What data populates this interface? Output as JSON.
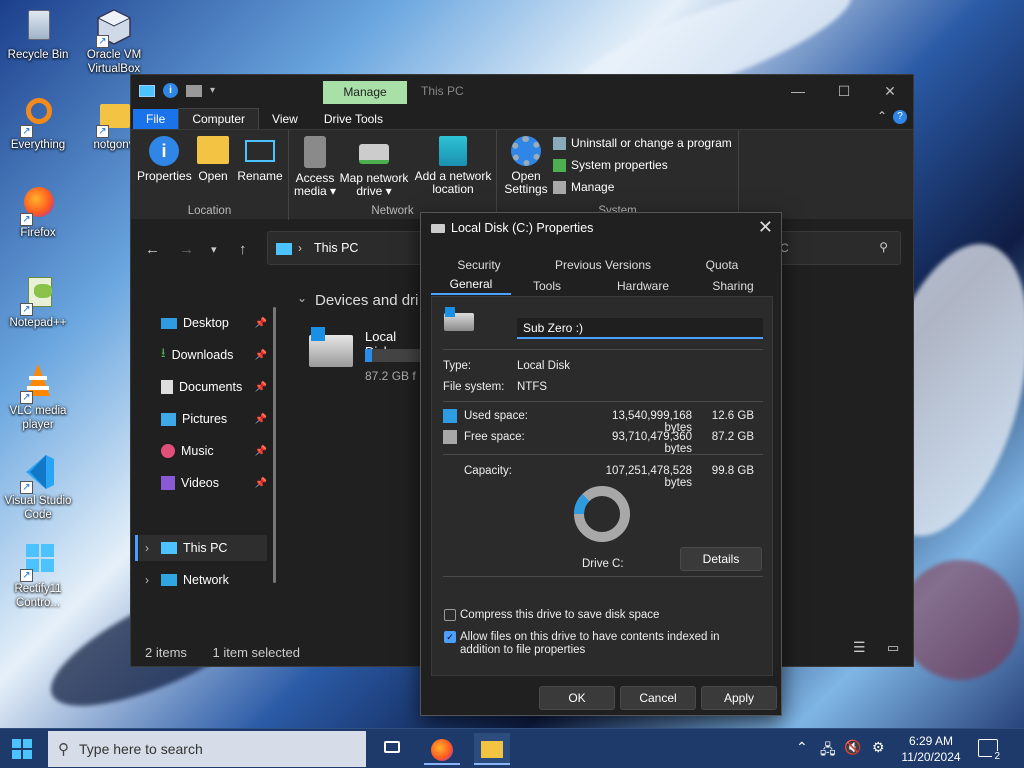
{
  "desktop": {
    "icons": [
      {
        "label": "Recycle Bin"
      },
      {
        "label": "Oracle VM VirtualBox"
      },
      {
        "label": "Everything"
      },
      {
        "label": "notgonv"
      },
      {
        "label": "Firefox"
      },
      {
        "label": "Notepad++"
      },
      {
        "label": "VLC media player"
      },
      {
        "label": "Visual Studio Code"
      },
      {
        "label": "Rectify11 Contro..."
      }
    ]
  },
  "explorer": {
    "manage_tab": "Manage",
    "title": "This PC",
    "tabs": [
      "File",
      "Computer",
      "View",
      "Drive Tools"
    ],
    "ribbon": {
      "location": {
        "name": "Location",
        "buttons": [
          "Properties",
          "Open",
          "Rename"
        ]
      },
      "network": {
        "name": "Network",
        "buttons": [
          "Access media ▾",
          "Map network drive ▾",
          "Add a network location"
        ]
      },
      "system": {
        "name": "System",
        "open_settings": "Open Settings",
        "items": [
          "Uninstall or change a program",
          "System properties",
          "Manage"
        ]
      }
    },
    "address": "This PC",
    "search_partial": "C",
    "section_header": "Devices and dri",
    "drive": {
      "name": "Local Disk",
      "free": "87.2 GB f",
      "used_fraction": 0.126
    },
    "nav": [
      {
        "label": "Desktop",
        "pinned": true
      },
      {
        "label": "Downloads",
        "pinned": true
      },
      {
        "label": "Documents",
        "pinned": true
      },
      {
        "label": "Pictures",
        "pinned": true
      },
      {
        "label": "Music",
        "pinned": true
      },
      {
        "label": "Videos",
        "pinned": true
      },
      {
        "label": "This PC",
        "pinned": false
      },
      {
        "label": "Network",
        "pinned": false
      }
    ],
    "status": {
      "items": "2 items",
      "selected": "1 item selected"
    }
  },
  "dialog": {
    "title": "Local Disk (C:) Properties",
    "tabs_row1": [
      "Security",
      "Previous Versions",
      "Quota"
    ],
    "tabs_row2": [
      "General",
      "Tools",
      "Hardware",
      "Sharing"
    ],
    "drive_label_value": "Sub Zero :)",
    "type_label": "Type:",
    "type_value": "Local Disk",
    "fs_label": "File system:",
    "fs_value": "NTFS",
    "used_label": "Used space:",
    "used_bytes": "13,540,999,168 bytes",
    "used_gb": "12.6 GB",
    "free_label": "Free space:",
    "free_bytes": "93,710,479,360 bytes",
    "free_gb": "87.2 GB",
    "capacity_label": "Capacity:",
    "capacity_bytes": "107,251,478,528 bytes",
    "capacity_gb": "99.8 GB",
    "drive_caption": "Drive C:",
    "details_button": "Details",
    "compress_label": "Compress this drive to save disk space",
    "compress_checked": false,
    "index_label": "Allow files on this drive to have contents indexed in addition to file properties",
    "index_checked": true,
    "ok": "OK",
    "cancel": "Cancel",
    "apply": "Apply",
    "used_fraction": 0.126,
    "colors": {
      "used": "#2f9be0",
      "free": "#a8a8a8",
      "accent": "#4aa0ff"
    }
  },
  "taskbar": {
    "search_placeholder": "Type here to search",
    "time": "6:29 AM",
    "date": "11/20/2024",
    "notifications": "2"
  }
}
